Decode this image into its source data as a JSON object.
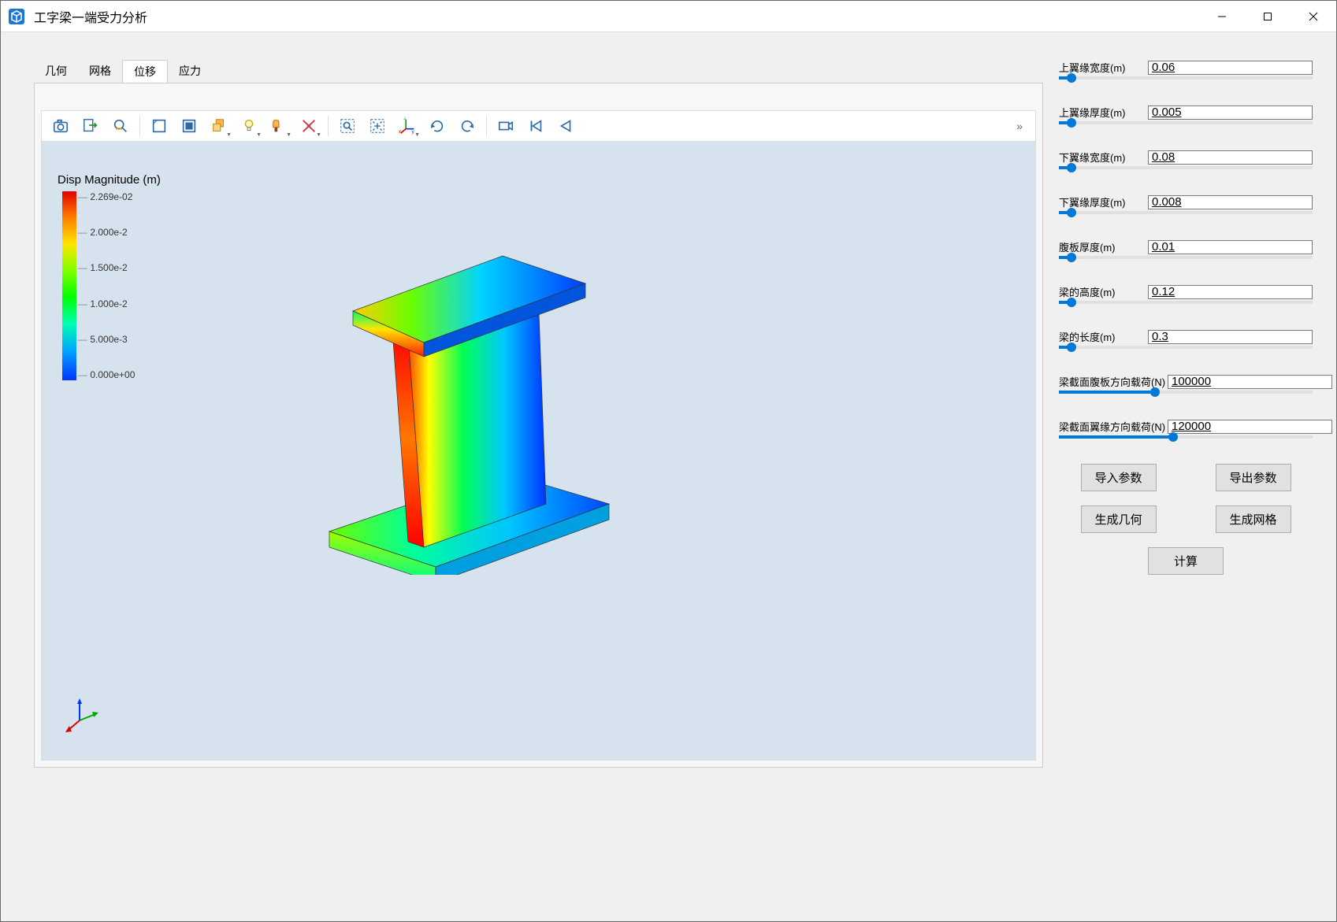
{
  "window": {
    "title": "工字梁一端受力分析"
  },
  "tabs": [
    {
      "label": "几何",
      "active": false
    },
    {
      "label": "网格",
      "active": false
    },
    {
      "label": "位移",
      "active": true
    },
    {
      "label": "应力",
      "active": false
    }
  ],
  "legend": {
    "title": "Disp Magnitude (m)",
    "ticks": [
      "2.269e-02",
      "2.000e-2",
      "1.500e-2",
      "1.000e-2",
      "5.000e-3",
      "0.000e+00"
    ]
  },
  "params": [
    {
      "label": "上翼缘宽度(m)",
      "value": "0.06",
      "pos": 5
    },
    {
      "label": "上翼缘厚度(m)",
      "value": "0.005",
      "pos": 5
    },
    {
      "label": "下翼缘宽度(m)",
      "value": "0.08",
      "pos": 5
    },
    {
      "label": "下翼缘厚度(m)",
      "value": "0.008",
      "pos": 5
    },
    {
      "label": "腹板厚度(m)",
      "value": "0.01",
      "pos": 5
    },
    {
      "label": "梁的高度(m)",
      "value": "0.12",
      "pos": 5
    },
    {
      "label": "梁的长度(m)",
      "value": "0.3",
      "pos": 5
    },
    {
      "label": "梁截面腹板方向载荷(N)",
      "value": "100000",
      "pos": 38
    },
    {
      "label": "梁截面翼缘方向载荷(N)",
      "value": "120000",
      "pos": 45
    }
  ],
  "buttons": {
    "importParams": "导入参数",
    "exportParams": "导出参数",
    "genGeometry": "生成几何",
    "genMesh": "生成网格",
    "calculate": "计算"
  },
  "toolbarIcons": [
    "camera-icon",
    "export-icon",
    "zoom-inspect-icon",
    "box-outline-icon",
    "box-filled-icon",
    "multi-box-icon",
    "lightbulb-icon",
    "brush-icon",
    "ruler-icon",
    "zoom-region-icon",
    "fit-region-icon",
    "axes-triad-icon",
    "rotate-ccw-icon",
    "rotate-cw-icon",
    "camera2-icon",
    "skip-prev-icon",
    "skip-back-icon"
  ]
}
